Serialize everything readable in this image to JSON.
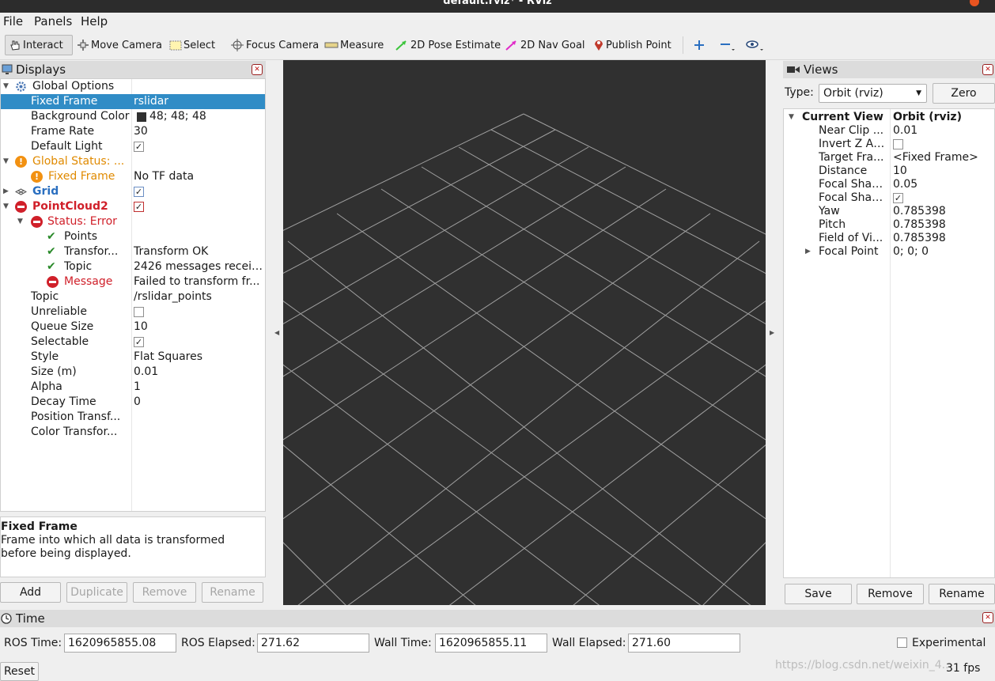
{
  "window": {
    "title": "default.rviz* - RViz"
  },
  "menubar": {
    "items": [
      "File",
      "Panels",
      "Help"
    ]
  },
  "toolbar": {
    "tools": [
      {
        "label": "Interact",
        "active": true
      },
      {
        "label": "Move Camera"
      },
      {
        "label": "Select"
      },
      {
        "label": "Focus Camera"
      },
      {
        "label": "Measure"
      },
      {
        "label": "2D Pose Estimate"
      },
      {
        "label": "2D Nav Goal"
      },
      {
        "label": "Publish Point"
      }
    ]
  },
  "displays": {
    "title": "Displays",
    "rows": [
      {
        "key": "Global Options",
        "value": ""
      },
      {
        "key": "Fixed Frame",
        "value": "rslidar"
      },
      {
        "key": "Background Color",
        "value": "48; 48; 48"
      },
      {
        "key": "Frame Rate",
        "value": "30"
      },
      {
        "key": "Default Light",
        "value": "✓"
      },
      {
        "key": "Global Status: ...",
        "value": ""
      },
      {
        "key": "Fixed Frame",
        "value": "No TF data"
      },
      {
        "key": "Grid",
        "value": "✓"
      },
      {
        "key": "PointCloud2",
        "value": "✓"
      },
      {
        "key": "Status: Error",
        "value": ""
      },
      {
        "key": "Points",
        "value": ""
      },
      {
        "key": "Transfor...",
        "value": "Transform OK"
      },
      {
        "key": "Topic",
        "value": "2426 messages receiv..."
      },
      {
        "key": "Message",
        "value": "Failed to transform fr..."
      },
      {
        "key": "Topic",
        "value": "/rslidar_points"
      },
      {
        "key": "Unreliable",
        "value": ""
      },
      {
        "key": "Queue Size",
        "value": "10"
      },
      {
        "key": "Selectable",
        "value": "✓"
      },
      {
        "key": "Style",
        "value": "Flat Squares"
      },
      {
        "key": "Size (m)",
        "value": "0.01"
      },
      {
        "key": "Alpha",
        "value": "1"
      },
      {
        "key": "Decay Time",
        "value": "0"
      },
      {
        "key": "Position Transf...",
        "value": ""
      },
      {
        "key": "Color Transfor...",
        "value": ""
      }
    ],
    "description_title": "Fixed Frame",
    "description_text": "Frame into which all data is transformed before being displayed.",
    "buttons": {
      "add": "Add",
      "duplicate": "Duplicate",
      "remove": "Remove",
      "rename": "Rename"
    }
  },
  "views": {
    "title": "Views",
    "type_label": "Type:",
    "type_value": "Orbit (rviz)",
    "zero_label": "Zero",
    "current_view": {
      "key": "Current View",
      "value": "Orbit (rviz)"
    },
    "rows": [
      {
        "key": "Near Clip ...",
        "value": "0.01"
      },
      {
        "key": "Invert Z Axis",
        "value": ""
      },
      {
        "key": "Target Fra...",
        "value": "<Fixed Frame>"
      },
      {
        "key": "Distance",
        "value": "10"
      },
      {
        "key": "Focal Shap...",
        "value": "0.05"
      },
      {
        "key": "Focal Shap...",
        "value": "✓"
      },
      {
        "key": "Yaw",
        "value": "0.785398"
      },
      {
        "key": "Pitch",
        "value": "0.785398"
      },
      {
        "key": "Field of Vi...",
        "value": "0.785398"
      },
      {
        "key": "Focal Point",
        "value": "0; 0; 0"
      }
    ],
    "buttons": {
      "save": "Save",
      "remove": "Remove",
      "rename": "Rename"
    }
  },
  "time": {
    "title": "Time",
    "ros_time_label": "ROS Time:",
    "ros_time": "1620965855.08",
    "ros_elapsed_label": "ROS Elapsed:",
    "ros_elapsed": "271.62",
    "wall_time_label": "Wall Time:",
    "wall_time": "1620965855.11",
    "wall_elapsed_label": "Wall Elapsed:",
    "wall_elapsed": "271.60",
    "experimental_label": "Experimental",
    "reset_label": "Reset",
    "fps": "31 fps",
    "watermark": "https://blog.csdn.net/weixin_4..."
  },
  "colors": {
    "selection": "#308cc6",
    "viewport_bg": "#303030",
    "grid": "#a0a0a0",
    "error": "#d0202a",
    "warning": "#f29111"
  }
}
